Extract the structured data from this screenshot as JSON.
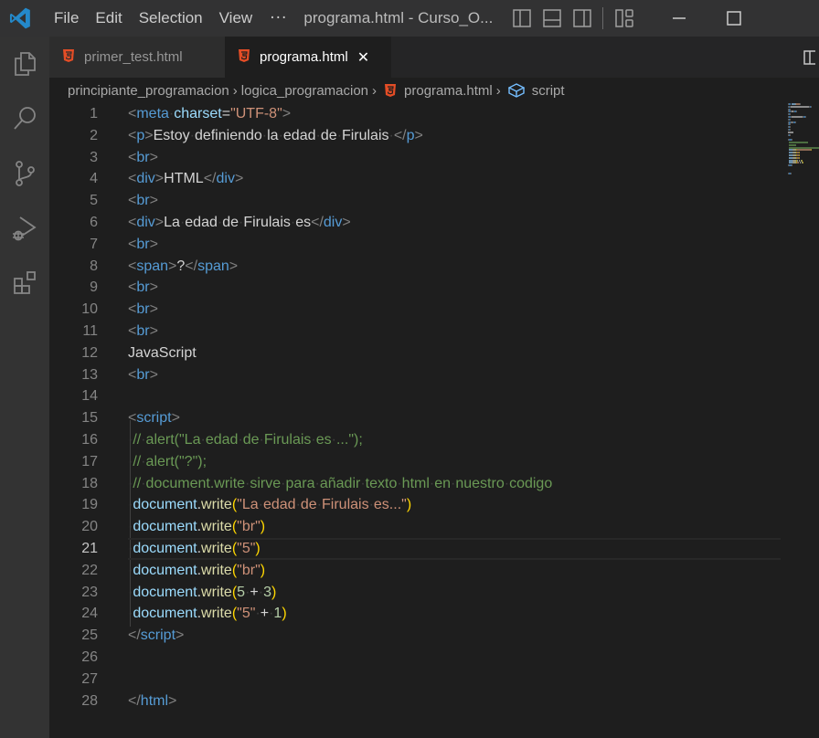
{
  "titlebar": {
    "menu": [
      "File",
      "Edit",
      "Selection",
      "View"
    ],
    "more": "···",
    "window_title": "programa.html - Curso_O..."
  },
  "activity_bar": {
    "items": [
      "explorer",
      "search",
      "source-control",
      "run-and-debug",
      "extensions"
    ]
  },
  "tabs": [
    {
      "label": "primer_test.html",
      "active": false
    },
    {
      "label": "programa.html",
      "active": true,
      "close": "✕"
    }
  ],
  "breadcrumb": {
    "items": [
      "principiante_programacion",
      "logica_programacion",
      "programa.html",
      "script"
    ],
    "separator": "›"
  },
  "editor": {
    "current_line": 21,
    "lines": [
      {
        "n": "1",
        "tokens": [
          [
            "<",
            "t-punct"
          ],
          [
            "meta",
            "t-tag"
          ],
          [
            "·",
            "ws"
          ],
          [
            "charset",
            "t-attr"
          ],
          [
            "=",
            "t-text"
          ],
          [
            "\"UTF-8\"",
            "t-str"
          ],
          [
            ">",
            "t-punct"
          ]
        ]
      },
      {
        "n": "2",
        "tokens": [
          [
            "<",
            "t-punct"
          ],
          [
            "p",
            "t-tag"
          ],
          [
            ">",
            "t-punct"
          ],
          [
            "Estoy·definiendo·la·edad·de·Firulais·",
            "t-text"
          ],
          [
            "</",
            "t-punct"
          ],
          [
            "p",
            "t-tag"
          ],
          [
            ">",
            "t-punct"
          ]
        ]
      },
      {
        "n": "3",
        "tokens": [
          [
            "<",
            "t-punct"
          ],
          [
            "br",
            "t-tag"
          ],
          [
            ">",
            "t-punct"
          ]
        ]
      },
      {
        "n": "4",
        "tokens": [
          [
            "<",
            "t-punct"
          ],
          [
            "div",
            "t-tag"
          ],
          [
            ">",
            "t-punct"
          ],
          [
            "HTML",
            "t-text"
          ],
          [
            "</",
            "t-punct"
          ],
          [
            "div",
            "t-tag"
          ],
          [
            ">",
            "t-punct"
          ]
        ]
      },
      {
        "n": "5",
        "tokens": [
          [
            "<",
            "t-punct"
          ],
          [
            "br",
            "t-tag"
          ],
          [
            ">",
            "t-punct"
          ]
        ]
      },
      {
        "n": "6",
        "tokens": [
          [
            "<",
            "t-punct"
          ],
          [
            "div",
            "t-tag"
          ],
          [
            ">",
            "t-punct"
          ],
          [
            "La·edad·de·Firulais·es",
            "t-text"
          ],
          [
            "</",
            "t-punct"
          ],
          [
            "div",
            "t-tag"
          ],
          [
            ">",
            "t-punct"
          ]
        ]
      },
      {
        "n": "7",
        "tokens": [
          [
            "<",
            "t-punct"
          ],
          [
            "br",
            "t-tag"
          ],
          [
            ">",
            "t-punct"
          ]
        ]
      },
      {
        "n": "8",
        "tokens": [
          [
            "<",
            "t-punct"
          ],
          [
            "span",
            "t-tag"
          ],
          [
            ">",
            "t-punct"
          ],
          [
            "?",
            "t-text"
          ],
          [
            "</",
            "t-punct"
          ],
          [
            "span",
            "t-tag"
          ],
          [
            ">",
            "t-punct"
          ]
        ]
      },
      {
        "n": "9",
        "tokens": [
          [
            "<",
            "t-punct"
          ],
          [
            "br",
            "t-tag"
          ],
          [
            ">",
            "t-punct"
          ]
        ]
      },
      {
        "n": "10",
        "tokens": [
          [
            "<",
            "t-punct"
          ],
          [
            "br",
            "t-tag"
          ],
          [
            ">",
            "t-punct"
          ]
        ]
      },
      {
        "n": "11",
        "tokens": [
          [
            "<",
            "t-punct"
          ],
          [
            "br",
            "t-tag"
          ],
          [
            ">",
            "t-punct"
          ]
        ]
      },
      {
        "n": "12",
        "tokens": [
          [
            "JavaScript",
            "t-text"
          ]
        ]
      },
      {
        "n": "13",
        "tokens": [
          [
            "<",
            "t-punct"
          ],
          [
            "br",
            "t-tag"
          ],
          [
            ">",
            "t-punct"
          ]
        ]
      },
      {
        "n": "14",
        "tokens": []
      },
      {
        "n": "15",
        "tokens": [
          [
            "<",
            "t-punct"
          ],
          [
            "script",
            "t-tag"
          ],
          [
            ">",
            "t-punct"
          ]
        ]
      },
      {
        "n": "16",
        "tokens": [
          [
            "·",
            "ws"
          ],
          [
            "//·alert(\"La·edad·de·Firulais·es·...\");",
            "t-comment"
          ]
        ]
      },
      {
        "n": "17",
        "tokens": [
          [
            "·",
            "ws"
          ],
          [
            "//·alert(\"?\");",
            "t-comment"
          ]
        ]
      },
      {
        "n": "18",
        "tokens": [
          [
            "·",
            "ws"
          ],
          [
            "//·document.write·sirve·para·añadir·texto·html·en·nuestro·codigo",
            "t-comment"
          ]
        ]
      },
      {
        "n": "19",
        "tokens": [
          [
            "·",
            "ws"
          ],
          [
            "document",
            "t-var"
          ],
          [
            ".",
            "t-text"
          ],
          [
            "write",
            "t-fn"
          ],
          [
            "(",
            "t-paren"
          ],
          [
            "\"La·edad·de·Firulais·es...\"",
            "t-str"
          ],
          [
            ")",
            "t-paren"
          ]
        ]
      },
      {
        "n": "20",
        "tokens": [
          [
            "·",
            "ws"
          ],
          [
            "document",
            "t-var"
          ],
          [
            ".",
            "t-text"
          ],
          [
            "write",
            "t-fn"
          ],
          [
            "(",
            "t-paren"
          ],
          [
            "\"br\"",
            "t-str"
          ],
          [
            ")",
            "t-paren"
          ]
        ]
      },
      {
        "n": "21",
        "tokens": [
          [
            "·",
            "ws"
          ],
          [
            "document",
            "t-var"
          ],
          [
            ".",
            "t-text"
          ],
          [
            "write",
            "t-fn"
          ],
          [
            "(",
            "t-paren"
          ],
          [
            "\"5\"",
            "t-str"
          ],
          [
            ")",
            "t-paren"
          ]
        ]
      },
      {
        "n": "22",
        "tokens": [
          [
            "·",
            "ws"
          ],
          [
            "document",
            "t-var"
          ],
          [
            ".",
            "t-text"
          ],
          [
            "write",
            "t-fn"
          ],
          [
            "(",
            "t-paren"
          ],
          [
            "\"br\"",
            "t-str"
          ],
          [
            ")",
            "t-paren"
          ]
        ]
      },
      {
        "n": "23",
        "tokens": [
          [
            "·",
            "ws"
          ],
          [
            "document",
            "t-var"
          ],
          [
            ".",
            "t-text"
          ],
          [
            "write",
            "t-fn"
          ],
          [
            "(",
            "t-paren"
          ],
          [
            "5",
            "t-num"
          ],
          [
            "·",
            "ws"
          ],
          [
            "+",
            "t-op"
          ],
          [
            "·",
            "ws"
          ],
          [
            "3",
            "t-num"
          ],
          [
            ")",
            "t-paren"
          ]
        ]
      },
      {
        "n": "24",
        "tokens": [
          [
            "·",
            "ws"
          ],
          [
            "document",
            "t-var"
          ],
          [
            ".",
            "t-text"
          ],
          [
            "write",
            "t-fn"
          ],
          [
            "(",
            "t-paren"
          ],
          [
            "\"5\"",
            "t-str"
          ],
          [
            "·",
            "ws"
          ],
          [
            "+",
            "t-op"
          ],
          [
            "·",
            "ws"
          ],
          [
            "1",
            "t-num"
          ],
          [
            ")",
            "t-paren"
          ]
        ]
      },
      {
        "n": "25",
        "tokens": [
          [
            "</",
            "t-punct"
          ],
          [
            "script",
            "t-tag"
          ],
          [
            ">",
            "t-punct"
          ]
        ]
      },
      {
        "n": "26",
        "tokens": []
      },
      {
        "n": "27",
        "tokens": []
      },
      {
        "n": "28",
        "tokens": [
          [
            "</",
            "t-punct"
          ],
          [
            "html",
            "t-tag"
          ],
          [
            ">",
            "t-punct"
          ]
        ]
      }
    ]
  },
  "colors": {
    "titlebar_bg": "#323233",
    "activitybar_bg": "#333333",
    "editor_bg": "#1e1e1e",
    "html5_icon": "#e44d26",
    "vscode_blue": "#2489ca",
    "script_icon": "#75beff"
  }
}
